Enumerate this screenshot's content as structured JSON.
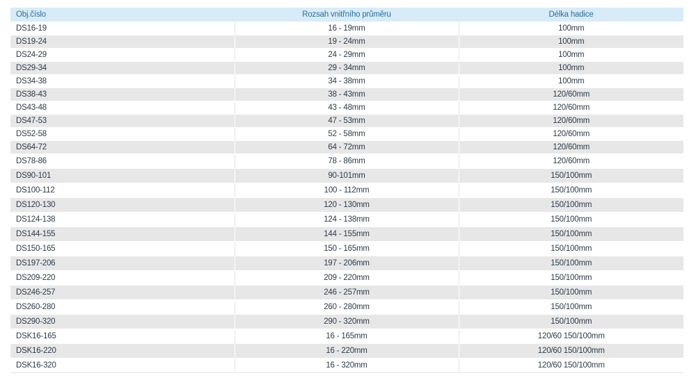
{
  "table": {
    "headers": [
      "Obj.číslo",
      "Rozsah vnitřního průměru",
      "Délka hadice"
    ],
    "rows": [
      [
        "DS16-19",
        "16 - 19mm",
        "100mm"
      ],
      [
        "DS19-24",
        "19 - 24mm",
        "100mm"
      ],
      [
        "DS24-29",
        "24 - 29mm",
        "100mm"
      ],
      [
        "DS29-34",
        "29 - 34mm",
        "100mm"
      ],
      [
        "DS34-38",
        "34 - 38mm",
        "100mm"
      ],
      [
        "DS38-43",
        "38 - 43mm",
        "120/60mm"
      ],
      [
        "DS43-48",
        "43 - 48mm",
        "120/60mm"
      ],
      [
        "DS47-53",
        "47 - 53mm",
        "120/60mm"
      ],
      [
        "DS52-58",
        "52 - 58mm",
        "120/60mm"
      ],
      [
        "DS64-72",
        "64 - 72mm",
        "120/60mm"
      ],
      [
        "DS78-86",
        "78 - 86mm",
        "120/60mm"
      ],
      [
        "DS90-101",
        "90-101mm",
        "150/100mm"
      ],
      [
        "DS100-112",
        "100 - 112mm",
        "150/100mm"
      ],
      [
        "DS120-130",
        "120 - 130mm",
        "150/100mm"
      ],
      [
        "DS124-138",
        "124 - 138mm",
        "150/100mm"
      ],
      [
        "DS144-155",
        "144 - 155mm",
        "150/100mm"
      ],
      [
        "DS150-165",
        "150 - 165mm",
        "150/100mm"
      ],
      [
        "DS197-206",
        "197 - 206mm",
        "150/100mm"
      ],
      [
        "DS209-220",
        "209 - 220mm",
        "150/100mm"
      ],
      [
        "DS246-257",
        "246 - 257mm",
        "150/100mm"
      ],
      [
        "DS260-280",
        "260 - 280mm",
        "150/100mm"
      ],
      [
        "DS290-320",
        "290 - 320mm",
        "150/100mm"
      ],
      [
        "DSK16-165",
        "16 - 165mm",
        "120/60 150/100mm"
      ],
      [
        "DSK16-220",
        "16 - 220mm",
        "120/60 150/100mm"
      ],
      [
        "DSK16-320",
        "16 - 320mm",
        "120/60 150/100mm"
      ]
    ]
  }
}
